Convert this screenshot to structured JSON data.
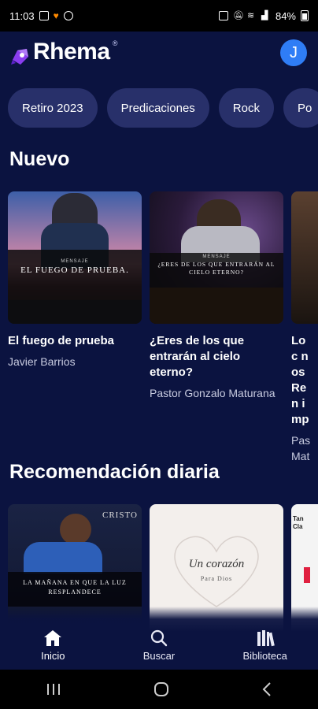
{
  "status_bar": {
    "time": "11:03",
    "battery": "84%"
  },
  "header": {
    "logo_text": "Rhema",
    "logo_reg": "®",
    "avatar_initial": "J"
  },
  "chips": [
    "Retiro 2023",
    "Predicaciones",
    "Rock",
    "Po"
  ],
  "sections": {
    "nuevo": {
      "title": "Nuevo",
      "cards": [
        {
          "title": "El fuego de prueba",
          "subtitle": "Javier Barrios",
          "thumb_text": "EL FUEGO DE PRUEBA.",
          "thumb_small": "MENSAJE"
        },
        {
          "title": "¿Eres de los que entrarán al cielo eterno?",
          "subtitle": "Pastor Gonzalo Maturana",
          "thumb_text": "¿ERES DE LOS QUE ENTRARÁN AL CIELO ETERNO?",
          "thumb_small": "MENSAJE"
        },
        {
          "title": "Lo c nos Ren imp",
          "subtitle": "Pas Mat"
        }
      ]
    },
    "recomendacion": {
      "title": "Recomendación diaria",
      "cards": [
        {
          "thumb_text": "LA MAÑANA EN QUE LA LUZ RESPLANDECE",
          "thumb_badge": "CRISTO"
        },
        {
          "thumb_text": "Un corazón",
          "thumb_small": "Para Dios"
        },
        {
          "thumb_text": "Tan Cla"
        }
      ]
    }
  },
  "bottom_nav": [
    {
      "label": "Inicio",
      "icon": "home-icon"
    },
    {
      "label": "Buscar",
      "icon": "search-icon"
    },
    {
      "label": "Biblioteca",
      "icon": "library-icon"
    }
  ],
  "colors": {
    "background": "#0b1340",
    "chip": "#28306a",
    "avatar": "#2f7df6",
    "accent": "#8a3df0"
  }
}
